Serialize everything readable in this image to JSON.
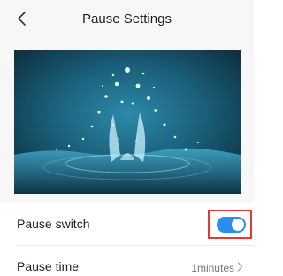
{
  "header": {
    "back_icon": "chevron-left-icon",
    "title": "Pause Settings"
  },
  "hero": {
    "image": "water-splash-photo"
  },
  "settings": {
    "pause_switch": {
      "label": "Pause switch",
      "enabled": true,
      "toggle_color": "#2a8df0",
      "highlight_color": "#e53935"
    },
    "pause_time": {
      "label": "Pause time",
      "value": "1minutes",
      "chevron_icon": "chevron-right-icon"
    }
  }
}
